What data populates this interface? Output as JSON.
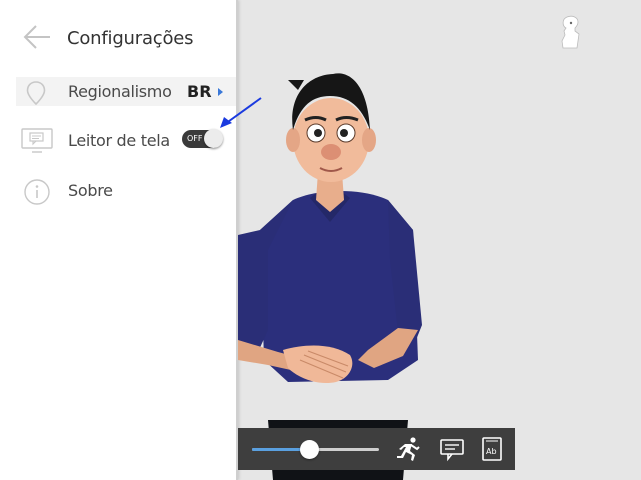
{
  "settings_panel": {
    "title": "Configurações",
    "back_icon": "arrow-left-icon",
    "items": [
      {
        "id": "regional",
        "label": "Regionalismo",
        "value": "BR",
        "icon": "map-pin-icon"
      },
      {
        "id": "reader",
        "label": "Leitor de tela",
        "toggle_text": "OFF",
        "toggle_on": false,
        "icon": "monitor-comment-icon"
      },
      {
        "id": "about",
        "label": "Sobre",
        "icon": "info-icon"
      }
    ]
  },
  "player_controls": {
    "speed_slider_value": 0.45,
    "buttons": [
      "running-man-icon",
      "subtitle-icon",
      "dictionary-icon"
    ]
  },
  "colors": {
    "accent": "#5aa0e0",
    "background": "#e6e6e6",
    "control_bar": "#3e3e3e",
    "annotation": "#1a3adf"
  }
}
